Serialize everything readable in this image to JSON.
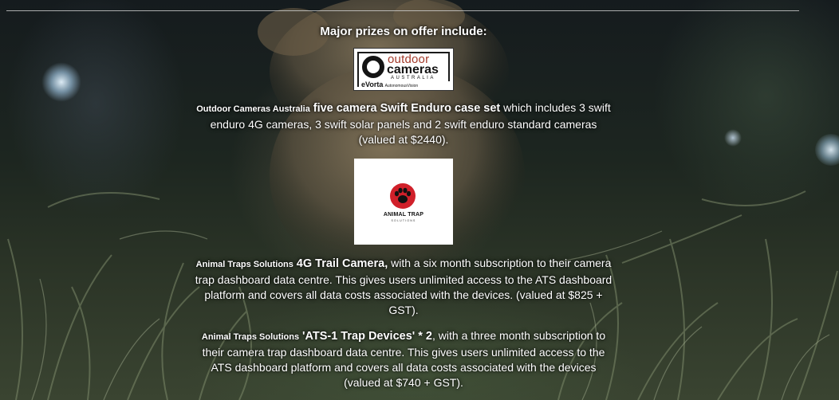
{
  "heading": "Major prizes on offer include:",
  "logos": {
    "oca": {
      "outdoor": "outdoor",
      "cameras": "cameras",
      "australia": "AUSTRALIA",
      "evorta": "eVorta",
      "evorta_tag": "AutonomousVision"
    },
    "ats": {
      "name": "ANIMAL TRAP",
      "sub": "SOLUTIONS"
    }
  },
  "prizes": [
    {
      "sponsor": "Outdoor Cameras Australia",
      "item": "five camera Swift Enduro case set",
      "rest": " which includes 3 swift enduro 4G cameras, 3 swift solar panels and 2 swift enduro standard cameras (valued at $2440)."
    },
    {
      "sponsor": "Animal Traps Solutions",
      "item": "4G Trail Camera,",
      "rest": " with a six month subscription to their camera trap dashboard data centre. This gives users unlimited access to the ATS dashboard platform and covers all data costs associated with the devices. (valued at $825 + GST)."
    },
    {
      "sponsor": "Animal Traps Solutions",
      "item": "'ATS-1 Trap Devices' * 2",
      "rest": ", with a three month subscription to their camera trap dashboard data centre. This gives users unlimited access to the ATS dashboard platform and covers all data costs associated with the devices (valued at $740 + GST)."
    }
  ],
  "colors": {
    "text": "#ffffff",
    "oca_red": "#a33a2a",
    "ats_red": "#d0202a"
  }
}
